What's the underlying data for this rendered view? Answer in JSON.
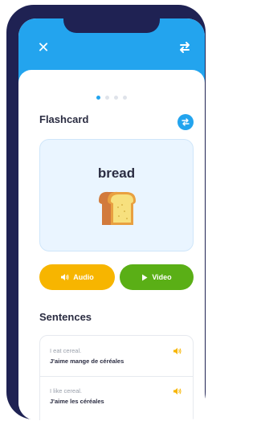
{
  "header": {
    "close_icon": "close-icon",
    "swap_icon": "swap-arrows-icon",
    "color": "#23a4ee"
  },
  "pagination": {
    "total": 4,
    "active": 1
  },
  "flashcard": {
    "title": "Flashcard",
    "refresh_icon": "swap-arrows-icon",
    "word": "bread",
    "image_icon": "bread-icon"
  },
  "buttons": {
    "audio_label": "Audio",
    "audio_icon": "speaker-icon",
    "audio_color": "#f7b500",
    "video_label": "Video",
    "video_icon": "play-icon",
    "video_color": "#5aaf16"
  },
  "sentences": {
    "title": "Sentences",
    "items": [
      {
        "english": "I eat cereal.",
        "french": "J'aime mange de céréales"
      },
      {
        "english": "I like cereal.",
        "french": "J'aime les céréales"
      }
    ]
  }
}
